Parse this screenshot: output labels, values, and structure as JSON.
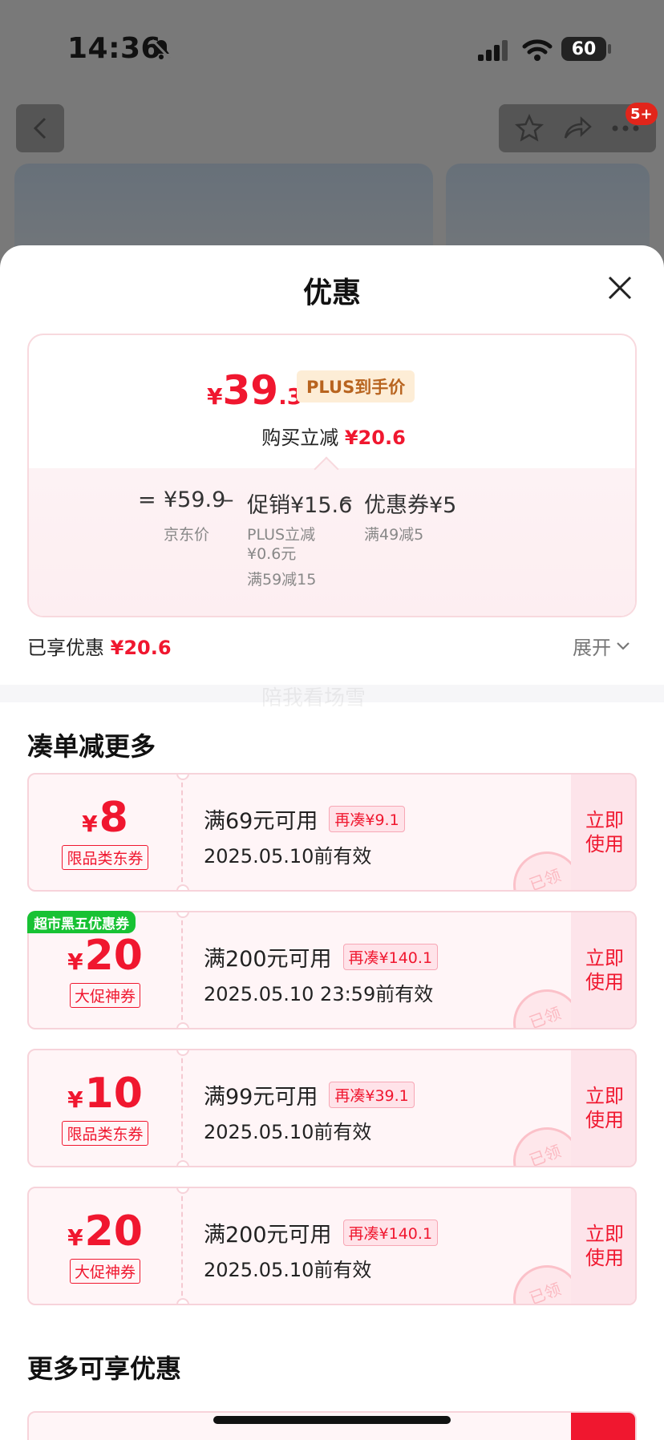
{
  "status": {
    "time": "14:36",
    "battery": "60"
  },
  "topbar": {
    "badge": "5+"
  },
  "sheet": {
    "title": "优惠",
    "price": {
      "yen": "¥",
      "integer": "39",
      "decimal": ".3",
      "tag": "PLUS到手价"
    },
    "save": {
      "label": "购买立减",
      "amount": "¥20.6"
    },
    "formula": {
      "eq": "=",
      "base": {
        "value": "¥59.9",
        "label": "京东价"
      },
      "minus1": "–",
      "promo": {
        "value": "促销¥15.6",
        "lines": [
          "PLUS立减",
          "¥0.6元",
          "满59减15"
        ]
      },
      "minus2": "–",
      "coupon": {
        "value": "优惠券¥5",
        "label": "满49减5"
      }
    },
    "enjoyed": {
      "label": "已享优惠",
      "amount": "¥20.6"
    },
    "expand": "展开",
    "watermark": "陪我看场雪",
    "section1": "凑单减更多",
    "coupons": [
      {
        "yen": "¥",
        "amount": "8",
        "type": "限品类东券",
        "condition": "满69元可用",
        "extra": "再凑¥9.1",
        "valid": "2025.05.10前有效",
        "action": "立即使用",
        "stamp": "已领"
      },
      {
        "yen": "¥",
        "amount": "20",
        "type": "大促神券",
        "condition": "满200元可用",
        "extra": "再凑¥140.1",
        "valid": "2025.05.10 23:59前有效",
        "action": "立即使用",
        "stamp": "已领",
        "tag": "超市黑五优惠券"
      },
      {
        "yen": "¥",
        "amount": "10",
        "type": "限品类东券",
        "condition": "满99元可用",
        "extra": "再凑¥39.1",
        "valid": "2025.05.10前有效",
        "action": "立即使用",
        "stamp": "已领"
      },
      {
        "yen": "¥",
        "amount": "20",
        "type": "大促神券",
        "condition": "满200元可用",
        "extra": "再凑¥140.1",
        "valid": "2025.05.10前有效",
        "action": "立即使用",
        "stamp": "已领"
      }
    ],
    "section2": "更多可享优惠"
  },
  "colors": {
    "accent": "#f0172f",
    "plus_tag_bg": "#fdedd6",
    "green_tag": "#18c234"
  }
}
